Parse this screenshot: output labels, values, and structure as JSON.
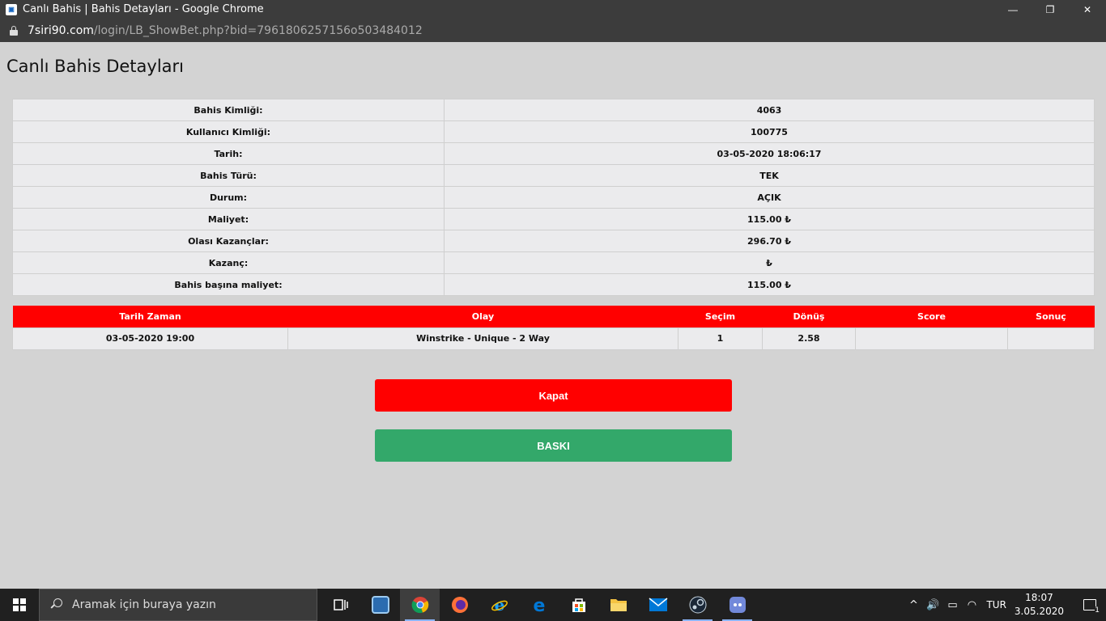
{
  "browser": {
    "window_title": "Canlı Bahis | Bahis Detayları - Google Chrome",
    "url_host": "7siri90.com",
    "url_path": "/login/LB_ShowBet.php?bid=7961806257156o503484012",
    "minimize_glyph": "—",
    "restore_glyph": "❐",
    "close_glyph": "✕"
  },
  "page": {
    "title": "Canlı Bahis Detayları",
    "details": [
      {
        "label": "Bahis Kimliği:",
        "value": "4063"
      },
      {
        "label": "Kullanıcı Kimliği:",
        "value": "100775"
      },
      {
        "label": "Tarih:",
        "value": "03-05-2020 18:06:17"
      },
      {
        "label": "Bahis Türü:",
        "value": "TEK"
      },
      {
        "label": "Durum:",
        "value": "AÇIK"
      },
      {
        "label": "Maliyet:",
        "value": "115.00 ₺"
      },
      {
        "label": "Olası Kazançlar:",
        "value": "296.70 ₺"
      },
      {
        "label": "Kazanç:",
        "value": "₺"
      },
      {
        "label": "Bahis başına maliyet:",
        "value": "115.00 ₺"
      }
    ],
    "events": {
      "headers": [
        "Tarih Zaman",
        "Olay",
        "Seçim",
        "Dönüş",
        "Score",
        "Sonuç"
      ],
      "rows": [
        [
          "03-05-2020 19:00",
          "Winstrike - Unique - 2 Way",
          "1",
          "2.58",
          "",
          ""
        ]
      ]
    },
    "close_button": "Kapat",
    "print_button": "BASKI"
  },
  "taskbar": {
    "search_placeholder": "Aramak için buraya yazın",
    "apps": [
      "task-view",
      "outlook",
      "chrome",
      "firefox",
      "internet-explorer",
      "edge",
      "store",
      "file-explorer",
      "mail",
      "steam",
      "discord"
    ],
    "tray_chevron": "^",
    "volume_glyph": "🔊",
    "battery_glyph": "▭",
    "wifi_glyph": "◠",
    "language": "TUR",
    "time": "18:07",
    "date": "3.05.2020",
    "notification_count": "1"
  }
}
